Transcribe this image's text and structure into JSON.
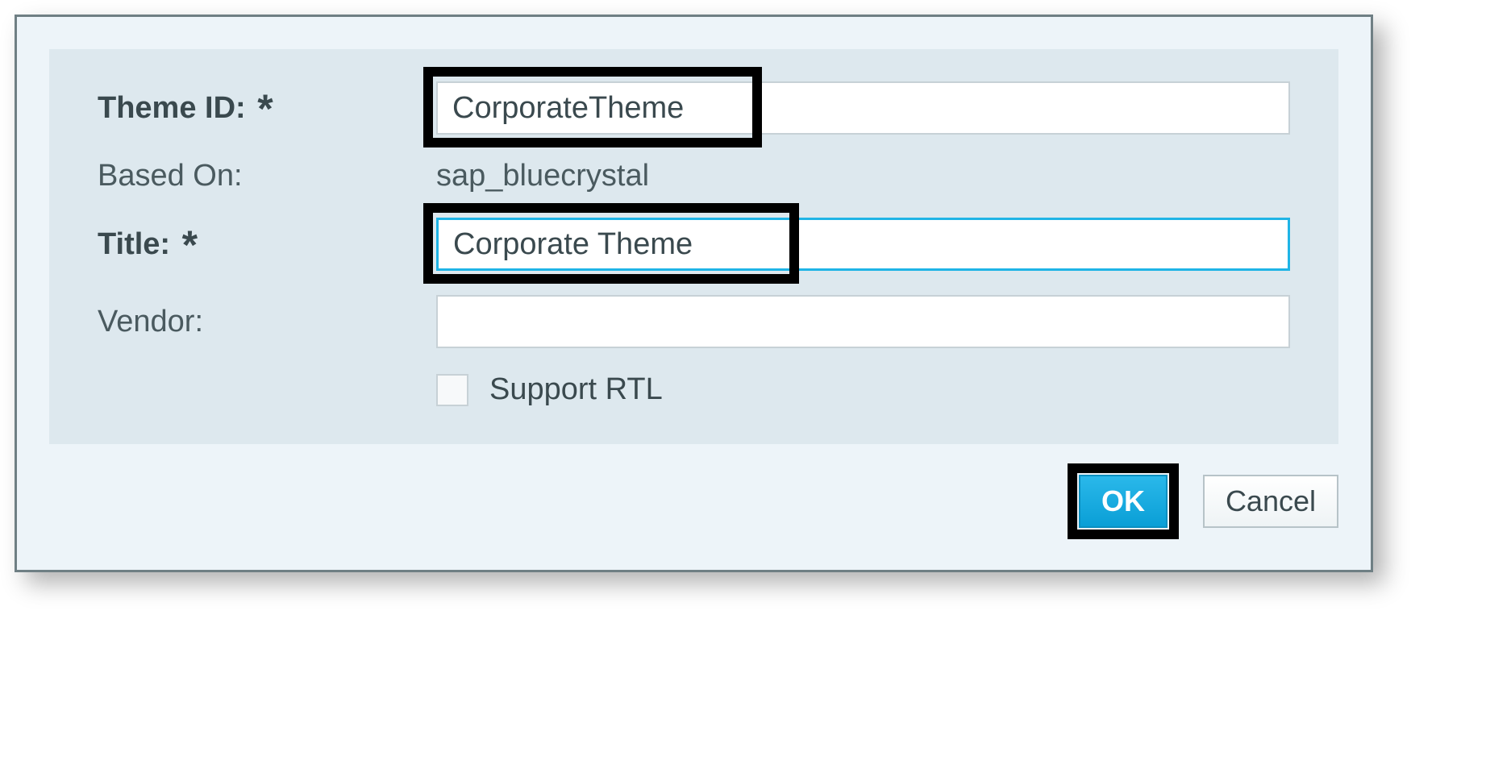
{
  "form": {
    "theme_id": {
      "label": "Theme ID:",
      "required_mark": "*",
      "value": "CorporateTheme"
    },
    "based_on": {
      "label": "Based On:",
      "value": "sap_bluecrystal"
    },
    "title": {
      "label": "Title:",
      "required_mark": "*",
      "value": "Corporate Theme"
    },
    "vendor": {
      "label": "Vendor:",
      "value": ""
    },
    "support_rtl": {
      "label": "Support RTL",
      "checked": false
    }
  },
  "buttons": {
    "ok": "OK",
    "cancel": "Cancel"
  }
}
